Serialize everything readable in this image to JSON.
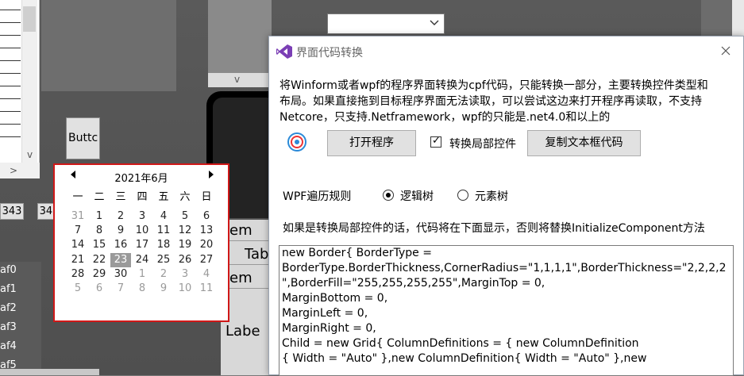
{
  "background_app": {
    "button_label": "Buttc",
    "num_box_1": "343",
    "num_box_2": "342",
    "left_items": [
      "af0",
      "af1",
      "af2",
      "af3",
      "af4",
      "af5"
    ],
    "grid_items": [
      "tem",
      "Tab",
      "tem"
    ],
    "label_text": "Labe",
    "combo_arrow_icon": "chevron-down-icon",
    "scroll_right_glyph": ">",
    "scroll_down_glyph": "v"
  },
  "calendar": {
    "title": "2021年6月",
    "prev_icon": "triangle-left-icon",
    "next_icon": "triangle-right-icon",
    "weekdays": [
      "一",
      "二",
      "三",
      "四",
      "五",
      "六",
      "日"
    ],
    "weeks": [
      [
        {
          "d": "31",
          "dim": true
        },
        {
          "d": "1"
        },
        {
          "d": "2"
        },
        {
          "d": "3"
        },
        {
          "d": "4"
        },
        {
          "d": "5"
        },
        {
          "d": "6"
        }
      ],
      [
        {
          "d": "7"
        },
        {
          "d": "8"
        },
        {
          "d": "9"
        },
        {
          "d": "10"
        },
        {
          "d": "11"
        },
        {
          "d": "12"
        },
        {
          "d": "13"
        }
      ],
      [
        {
          "d": "14"
        },
        {
          "d": "15"
        },
        {
          "d": "16"
        },
        {
          "d": "17"
        },
        {
          "d": "18"
        },
        {
          "d": "19"
        },
        {
          "d": "20"
        }
      ],
      [
        {
          "d": "21"
        },
        {
          "d": "22"
        },
        {
          "d": "23",
          "selected": true
        },
        {
          "d": "24"
        },
        {
          "d": "25"
        },
        {
          "d": "26"
        },
        {
          "d": "27"
        }
      ],
      [
        {
          "d": "28"
        },
        {
          "d": "29"
        },
        {
          "d": "30"
        },
        {
          "d": "1",
          "dim": true
        },
        {
          "d": "2",
          "dim": true
        },
        {
          "d": "3",
          "dim": true
        },
        {
          "d": "4",
          "dim": true
        }
      ],
      [
        {
          "d": "5",
          "dim": true
        },
        {
          "d": "6",
          "dim": true
        },
        {
          "d": "7",
          "dim": true
        },
        {
          "d": "8",
          "dim": true
        },
        {
          "d": "9",
          "dim": true
        },
        {
          "d": "10",
          "dim": true
        },
        {
          "d": "11",
          "dim": true
        }
      ]
    ],
    "border_color": "#d01818"
  },
  "dialog": {
    "title": "界面代码转换",
    "logo_icon": "visual-studio-logo-icon",
    "close_glyph": "✕",
    "description": [
      "将Winform或者wpf的程序界面转换为cpf代码，只能转换一部分，主要转换控件类型和",
      "布局。如果直接拖到目标程序界面无法读取，可以尝试这边来打开程序再读取，不支持",
      "Netcore，只支持.Netframework，wpf的只能是.net4.0和以上的"
    ],
    "target_icon": "target-icon",
    "open_button": "打开程序",
    "partial_checkbox": {
      "label": "转换局部控件",
      "checked": true
    },
    "copy_button": "复制文本框代码",
    "wpf_rule_label": "WPF遍历规则",
    "radio_logical": {
      "label": "逻辑树",
      "selected": true
    },
    "radio_visual": {
      "label": "元素树",
      "selected": false
    },
    "hint": "如果是转换局部控件的话，代码将在下面显示，否则将替换InitializeComponent方法",
    "code_lines": [
      "new Border{ BorderType =",
      "BorderType.BorderThickness,CornerRadius=\"1,1,1,1\",BorderThickness=\"2,2,2,2",
      "\",BorderFill=\"255,255,255,255\",MarginTop = 0,",
      "MarginBottom = 0,",
      "MarginLeft = 0,",
      "MarginRight = 0,",
      "Child = new Grid{ ColumnDefinitions = { new ColumnDefinition",
      "{ Width = \"Auto\" },new ColumnDefinition{ Width = \"Auto\" },new"
    ],
    "accent_color": "#68217a"
  }
}
